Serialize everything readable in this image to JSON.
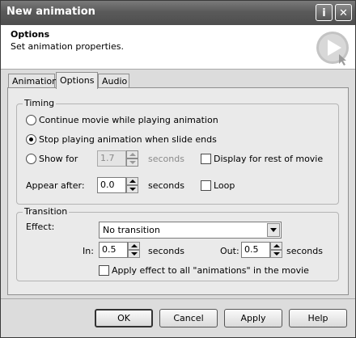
{
  "window": {
    "title": "New animation",
    "info_glyph": "i",
    "close_glyph": "✕"
  },
  "header": {
    "title": "Options",
    "subtitle": "Set animation properties.",
    "logo_icon": "play-icon"
  },
  "tabs": [
    {
      "label": "Animation",
      "active": false
    },
    {
      "label": "Options",
      "active": true
    },
    {
      "label": "Audio",
      "active": false
    }
  ],
  "timing": {
    "legend": "Timing",
    "continue_label": "Continue movie while playing animation",
    "stop_label": "Stop playing animation when slide ends",
    "show_for_label": "Show for",
    "show_for_value": "1.7",
    "show_for_units": "seconds",
    "display_rest_label": "Display for rest of movie",
    "appear_after_label": "Appear after:",
    "appear_after_value": "0.0",
    "appear_after_units": "seconds",
    "loop_label": "Loop",
    "selected": "stop"
  },
  "transition": {
    "legend": "Transition",
    "effect_label": "Effect:",
    "effect_value": "No transition",
    "in_label": "In:",
    "in_value": "0.5",
    "in_units": "seconds",
    "out_label": "Out:",
    "out_value": "0.5",
    "out_units": "seconds",
    "apply_all_label": "Apply effect to all \"animations\" in the movie"
  },
  "buttons": {
    "ok": "OK",
    "cancel": "Cancel",
    "apply": "Apply",
    "help": "Help"
  }
}
